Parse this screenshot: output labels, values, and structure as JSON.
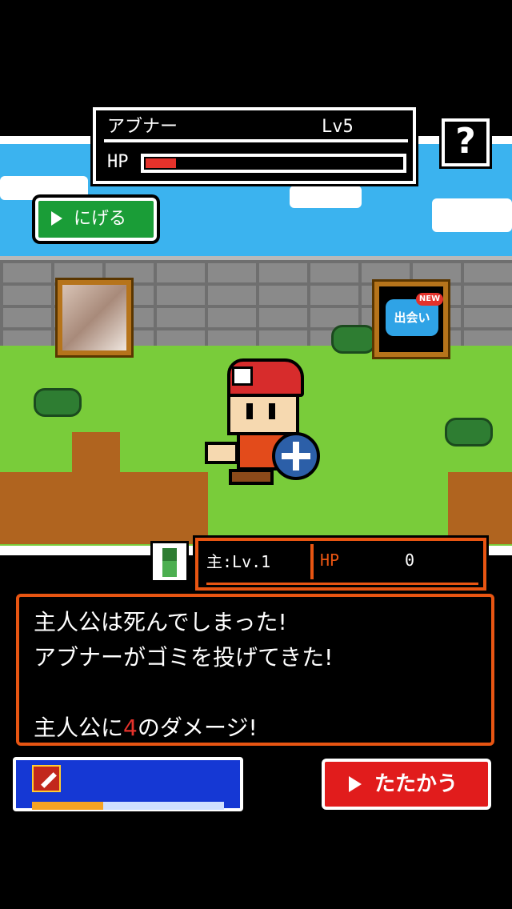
{
  "enemy": {
    "name": "アブナー",
    "level": "Lv5",
    "hp_label": "HP",
    "hp_fraction": 0.12
  },
  "help": {
    "label": "?"
  },
  "flee_button": {
    "label": "にげる"
  },
  "deai_banner": {
    "label": "出会い",
    "badge": "NEW"
  },
  "player": {
    "name": "主:Lv.1",
    "hp_label": "HP",
    "hp_value": "0"
  },
  "message": {
    "lines": [
      "主人公は死んでしまった!",
      "アブナーがゴミを投げてきた!",
      ""
    ],
    "damage_prefix": "主人公に",
    "damage_value": "4",
    "damage_suffix": "のダメージ!"
  },
  "skill": {
    "gauge_fraction": 0.37
  },
  "fight_button": {
    "label": "たたかう"
  },
  "colors": {
    "accent": "#e85512",
    "enemy_hp": "#e5322b",
    "fight": "#e11c1c",
    "flee": "#1a9d37",
    "skill_panel": "#1538d4"
  }
}
